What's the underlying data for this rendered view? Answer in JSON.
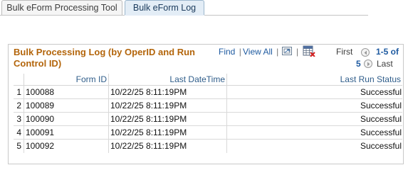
{
  "tabs": [
    {
      "label": "Bulk eForm Processing Tool",
      "active": false
    },
    {
      "label": "Bulk eForm Log",
      "active": true
    }
  ],
  "grid": {
    "title": "Bulk Processing Log (by OperID and Run Control ID)",
    "find_label": "Find",
    "separator": "|",
    "view_all_label": "View All",
    "first_label": "First",
    "range_part1": "1-5 of",
    "range_part2": "5",
    "last_label": "Last",
    "icons": [
      "zoom-icon",
      "download-grid-icon",
      "prev-arrow-icon",
      "next-arrow-icon"
    ],
    "columns": [
      "Form ID",
      "Last DateTime",
      "Last Run Status"
    ],
    "rows": [
      {
        "num": "1",
        "form_id": "100088",
        "datetime": "10/22/25  8:11:19PM",
        "status": "Successful"
      },
      {
        "num": "2",
        "form_id": "100089",
        "datetime": "10/22/25  8:11:19PM",
        "status": "Successful"
      },
      {
        "num": "3",
        "form_id": "100090",
        "datetime": "10/22/25  8:11:19PM",
        "status": "Successful"
      },
      {
        "num": "4",
        "form_id": "100091",
        "datetime": "10/22/25  8:11:19PM",
        "status": "Successful"
      },
      {
        "num": "5",
        "form_id": "100092",
        "datetime": "10/22/25  8:11:19PM",
        "status": "Successful"
      }
    ]
  },
  "colors": {
    "title": "#b3650b",
    "link": "#1e5aa0",
    "header_text": "#2f5d8a"
  }
}
